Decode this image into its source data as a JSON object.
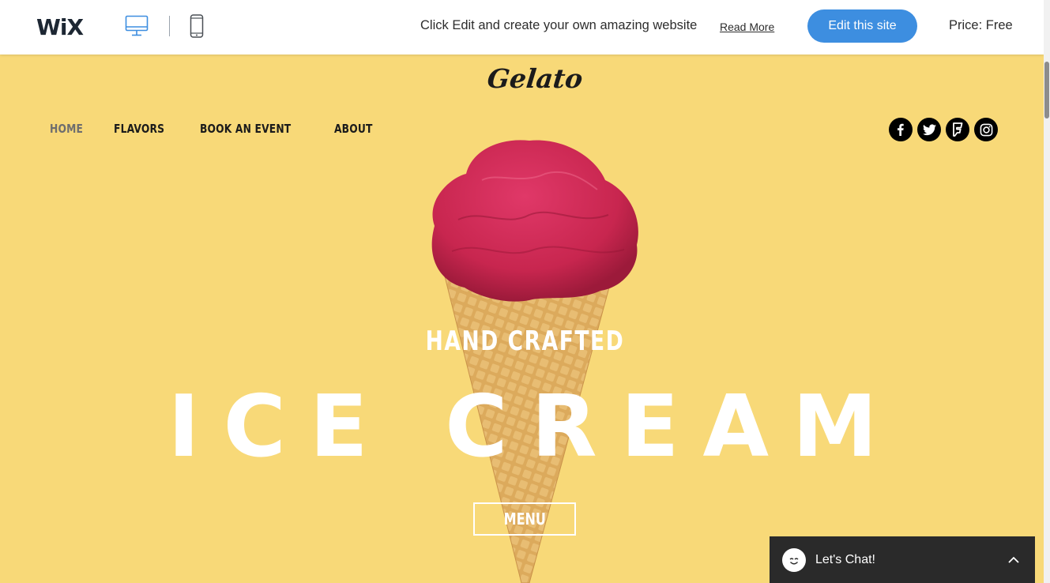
{
  "wixbar": {
    "logo": "WiX",
    "devices": [
      "desktop-icon",
      "mobile-icon"
    ],
    "promo_text": "Click Edit and create your own amazing website",
    "read_more": "Read More",
    "edit_button": "Edit this site",
    "price": "Price: Free"
  },
  "site": {
    "brand": "Gelato",
    "nav": [
      {
        "label": "HOME",
        "active": true
      },
      {
        "label": "FLAVORS",
        "active": false
      },
      {
        "label": "BOOK AN EVENT",
        "active": false
      },
      {
        "label": "ABOUT",
        "active": false
      }
    ],
    "social": [
      "facebook-icon",
      "twitter-icon",
      "foursquare-icon",
      "instagram-icon"
    ]
  },
  "hero": {
    "kicker": "HAND CRAFTED",
    "headline": "ICE CREAM",
    "menu_button": "MENU"
  },
  "chat": {
    "label": "Let's Chat!"
  },
  "colors": {
    "background": "#f8d978",
    "edit_button": "#3d8ee0",
    "chat_bg": "#2a2a2a",
    "scoop": "#c8264f",
    "cone": "#dcaa5c"
  }
}
